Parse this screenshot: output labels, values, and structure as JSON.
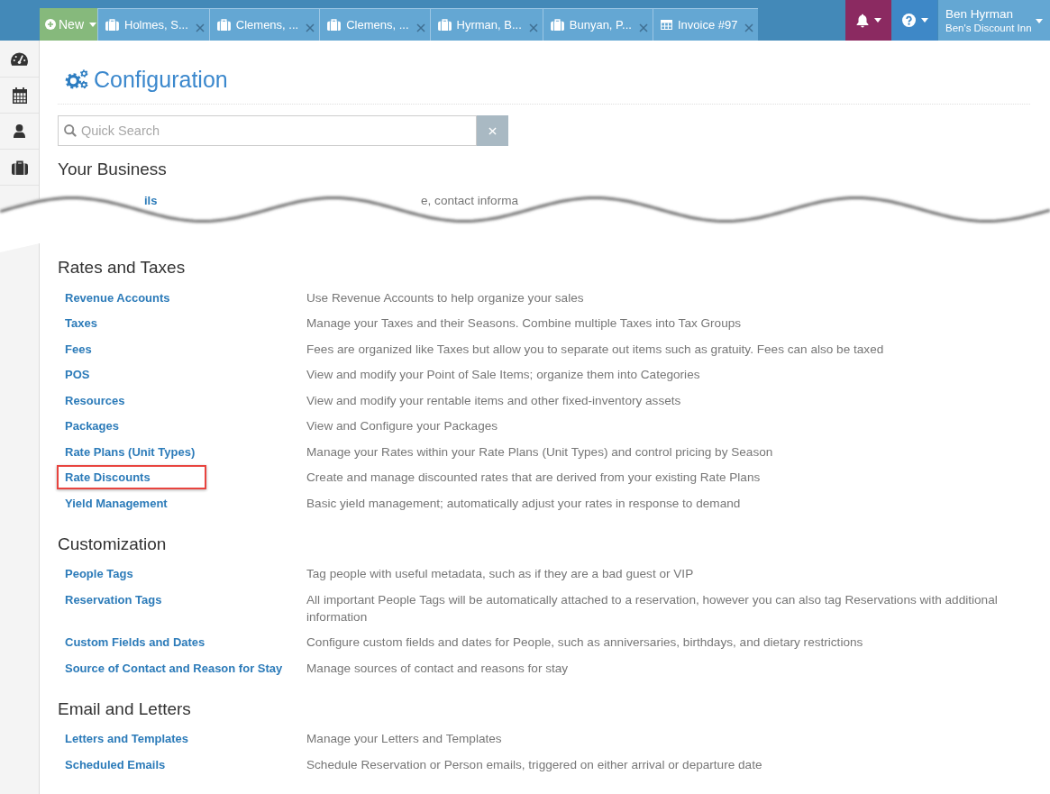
{
  "top_bar": {
    "new_button": {
      "label": "New"
    },
    "tabs": [
      {
        "label": "Holmes, S...",
        "kind": "reservation",
        "selected": false
      },
      {
        "label": "Clemens, ...",
        "kind": "reservation",
        "selected": false
      },
      {
        "label": "Clemens, ...",
        "kind": "reservation",
        "selected": false
      },
      {
        "label": "Hyrman, B...",
        "kind": "reservation",
        "selected": false
      },
      {
        "label": "Bunyan, P...",
        "kind": "reservation",
        "selected": false
      },
      {
        "label": "Invoice #97",
        "kind": "invoice",
        "selected": false
      }
    ],
    "user_menu": {
      "name": "Ben Hyrman",
      "property": "Ben's Discount Inn"
    }
  },
  "sidebar": {
    "items": [
      {
        "kind": "dashboard"
      },
      {
        "kind": "calendar"
      },
      {
        "kind": "people"
      },
      {
        "kind": "reservations"
      }
    ]
  },
  "upper_part": {
    "title": "Configuration",
    "search": {
      "placeholder": "Quick Search"
    },
    "section": {
      "heading": "Your Business",
      "cut_row": {
        "link": "ils",
        "description": "e, contact informa"
      }
    }
  },
  "lower_part": {
    "sections": [
      {
        "heading": "Rates and Taxes",
        "items": [
          {
            "link": "Revenue Accounts",
            "description": "Use Revenue Accounts to help organize your sales",
            "highlighted": false
          },
          {
            "link": "Taxes",
            "description": "Manage your Taxes and their Seasons. Combine multiple Taxes into Tax Groups",
            "highlighted": false
          },
          {
            "link": "Fees",
            "description": "Fees are organized like Taxes but allow you to separate out items such as gratuity. Fees can also be taxed",
            "highlighted": false
          },
          {
            "link": "POS",
            "description": "View and modify your Point of Sale Items; organize them into Categories",
            "highlighted": false
          },
          {
            "link": "Resources",
            "description": "View and modify your rentable items and other fixed-inventory assets",
            "highlighted": false
          },
          {
            "link": "Packages",
            "description": "View and Configure your Packages",
            "highlighted": false
          },
          {
            "link": "Rate Plans (Unit Types)",
            "description": "Manage your Rates within your Rate Plans (Unit Types) and control pricing by Season",
            "highlighted": false
          },
          {
            "link": "Rate Discounts",
            "description": "Create and manage discounted rates that are derived from your existing Rate Plans",
            "highlighted": true
          },
          {
            "link": "Yield Management",
            "description": "Basic yield management; automatically adjust your rates in response to demand",
            "highlighted": false
          }
        ]
      },
      {
        "heading": "Customization",
        "items": [
          {
            "link": "People Tags",
            "description": "Tag people with useful metadata, such as if they are a bad guest or VIP",
            "highlighted": false
          },
          {
            "link": "Reservation Tags",
            "description": "All important People Tags will be automatically attached to a reservation, however you can also tag Reservations with additional information",
            "highlighted": false
          },
          {
            "link": "Custom Fields and Dates",
            "description": "Configure custom fields and dates for People, such as anniversaries, birthdays, and dietary restrictions",
            "highlighted": false
          },
          {
            "link": "Source of Contact and Reason for Stay",
            "description": "Manage sources of contact and reasons for stay",
            "highlighted": false
          }
        ]
      },
      {
        "heading": "Email and Letters",
        "items": [
          {
            "link": "Letters and Templates",
            "description": "Manage your Letters and Templates",
            "highlighted": false
          },
          {
            "link": "Scheduled Emails",
            "description": "Schedule Reservation or Person emails, triggered on either arrival or departure date",
            "highlighted": false
          }
        ]
      }
    ]
  }
}
